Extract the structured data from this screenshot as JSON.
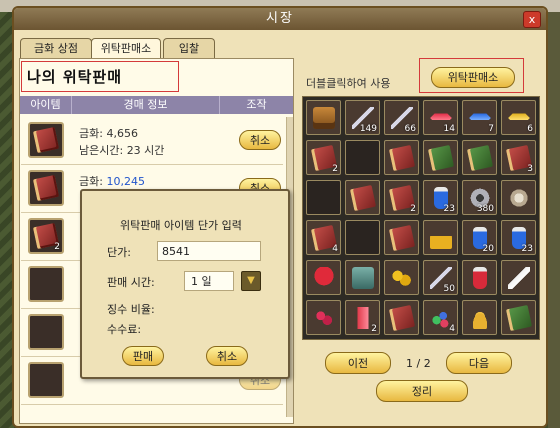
{
  "window": {
    "title": "시장",
    "close_label": "x"
  },
  "tabs": [
    {
      "label": "금화 상점",
      "active": false
    },
    {
      "label": "위탁판매소",
      "active": true
    },
    {
      "label": "입찰",
      "active": false
    }
  ],
  "left": {
    "title": "나의 위탁판매",
    "columns": [
      "아이템",
      "경매 정보",
      "조작"
    ],
    "rows": [
      {
        "price_label": "금화:",
        "price": "4,656",
        "time_label": "남은시간:",
        "time": "23 시간",
        "action": "취소",
        "qty": ""
      },
      {
        "price_label": "금화:",
        "price": "10,245",
        "time_label": "",
        "time": "",
        "action": "취소",
        "qty": ""
      },
      {
        "price_label": "",
        "price": "",
        "time_label": "",
        "time": "",
        "action": "",
        "qty": "2"
      },
      {
        "price_label": "",
        "price": "",
        "time_label": "",
        "time": "",
        "action": "",
        "qty": ""
      },
      {
        "price_label": "",
        "price": "",
        "time_label": "",
        "time": "",
        "action": "",
        "qty": ""
      },
      {
        "price_label": "",
        "price": "",
        "time_label": "",
        "time": "",
        "action": "취소",
        "qty": ""
      }
    ]
  },
  "dialog": {
    "title": "위탁판매 아이템 단가 입력",
    "unit_price_label": "단가:",
    "unit_price_value": "8541",
    "time_label": "판매 시간:",
    "time_value": "1 일",
    "fee_rate_label": "징수 비율:",
    "fee_label": "수수료:",
    "sell_button": "판매",
    "cancel_button": "취소"
  },
  "right": {
    "hint": "더블클릭하여 사용",
    "consign_button": "위탁판매소",
    "inventory": [
      {
        "icon": "treasure-chest-icon",
        "qty": ""
      },
      {
        "icon": "needle-icon",
        "qty": "149"
      },
      {
        "icon": "needle-icon",
        "qty": "66"
      },
      {
        "icon": "red-gem-icon",
        "qty": "14"
      },
      {
        "icon": "blue-gem-icon",
        "qty": "7"
      },
      {
        "icon": "yellow-gem-icon",
        "qty": "6"
      },
      {
        "icon": "red-book-icon",
        "qty": "2"
      },
      {
        "icon": "",
        "qty": ""
      },
      {
        "icon": "red-book-icon",
        "qty": ""
      },
      {
        "icon": "green-book-icon",
        "qty": ""
      },
      {
        "icon": "green-book-icon",
        "qty": ""
      },
      {
        "icon": "red-book-icon",
        "qty": "3"
      },
      {
        "icon": "",
        "qty": ""
      },
      {
        "icon": "red-book-icon",
        "qty": ""
      },
      {
        "icon": "red-book-icon",
        "qty": "2"
      },
      {
        "icon": "blue-potion-icon",
        "qty": "23"
      },
      {
        "icon": "gear-icon",
        "qty": "380"
      },
      {
        "icon": "flower-icon",
        "qty": ""
      },
      {
        "icon": "red-book-icon",
        "qty": "4"
      },
      {
        "icon": "",
        "qty": ""
      },
      {
        "icon": "red-book-icon",
        "qty": ""
      },
      {
        "icon": "gold-pile-icon",
        "qty": ""
      },
      {
        "icon": "blue-potion-icon",
        "qty": "20"
      },
      {
        "icon": "blue-potion-icon",
        "qty": "23"
      },
      {
        "icon": "strawberry-icon",
        "qty": ""
      },
      {
        "icon": "bag-icon",
        "qty": ""
      },
      {
        "icon": "gold-ore-icon",
        "qty": ""
      },
      {
        "icon": "needle-icon",
        "qty": "50"
      },
      {
        "icon": "red-potion-icon",
        "qty": ""
      },
      {
        "icon": "feather-icon",
        "qty": ""
      },
      {
        "icon": "berries-icon",
        "qty": ""
      },
      {
        "icon": "red-crystal-icon",
        "qty": "2"
      },
      {
        "icon": "red-book-icon",
        "qty": ""
      },
      {
        "icon": "gem-cluster-icon",
        "qty": "4"
      },
      {
        "icon": "hat-icon",
        "qty": ""
      },
      {
        "icon": "green-book-icon",
        "qty": ""
      }
    ],
    "prev_button": "이전",
    "page_text": "1 / 2",
    "next_button": "다음",
    "sort_button": "정리"
  },
  "colors": {
    "accent": "#e8b840",
    "highlight_box": "#d43a3a",
    "header_bg": "#8d84a8"
  }
}
